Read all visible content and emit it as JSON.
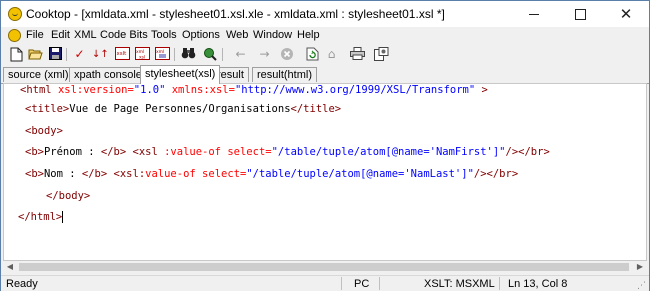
{
  "window": {
    "title": "Cooktop - [xmldata.xml - stylesheet01.xsl.xle - xmldata.xml : stylesheet01.xsl *]",
    "min_label": "",
    "max_label": "",
    "close_label": "✕"
  },
  "menu": {
    "items": [
      "File",
      "Edit",
      "XML",
      "Code Bits",
      "Tools",
      "Options",
      "Web",
      "Window",
      "Help"
    ]
  },
  "toolbar": {
    "buttons": [
      "new-file",
      "open-folder",
      "save",
      "check",
      "transform",
      "xslt",
      "xml-to-xsl",
      "xml-tree",
      "binoculars",
      "search-web",
      "back",
      "forward",
      "stop",
      "refresh",
      "home",
      "print",
      "options"
    ]
  },
  "tabs": {
    "items": [
      "source (xml)",
      "xpath console",
      "stylesheet(xsl)",
      "result",
      "result(html)"
    ],
    "active": "stylesheet(xsl)"
  },
  "editor": {
    "lines": [
      [
        {
          "c": "tag",
          "t": "<html "
        },
        {
          "c": "attr",
          "t": "xsl:version="
        },
        {
          "c": "val",
          "t": "\"1.0\""
        },
        {
          "c": "txt",
          "t": " "
        },
        {
          "c": "attr",
          "t": "xmlns:xsl="
        },
        {
          "c": "val",
          "t": "\"http://www.w3.org/1999/XSL/Transform\""
        },
        {
          "c": "tag",
          "t": " >"
        }
      ],
      [
        {
          "c": "tag",
          "t": "<title>"
        },
        {
          "c": "txt",
          "t": "Vue de Page Personnes/Organisations"
        },
        {
          "c": "tag",
          "t": "</title>"
        }
      ],
      [
        {
          "c": "tag",
          "t": "<body>"
        }
      ],
      [
        {
          "c": "tag",
          "t": "<b>"
        },
        {
          "c": "txt",
          "t": "Prénom : "
        },
        {
          "c": "tag",
          "t": "</b>"
        },
        {
          "c": "txt",
          "t": " "
        },
        {
          "c": "tag",
          "t": "<xsl "
        },
        {
          "c": "attr",
          "t": ":value-of"
        },
        {
          "c": "txt",
          "t": " "
        },
        {
          "c": "attr",
          "t": "select="
        },
        {
          "c": "val",
          "t": "\"/table/tuple/atom[@name='NamFirst']\""
        },
        {
          "c": "tag",
          "t": "/></br>"
        }
      ],
      [
        {
          "c": "tag",
          "t": "<b>"
        },
        {
          "c": "txt",
          "t": "Nom : "
        },
        {
          "c": "tag",
          "t": "</b>"
        },
        {
          "c": "txt",
          "t": " "
        },
        {
          "c": "tag",
          "t": "<xsl:"
        },
        {
          "c": "attr",
          "t": "value-of"
        },
        {
          "c": "txt",
          "t": " "
        },
        {
          "c": "attr",
          "t": "select="
        },
        {
          "c": "val",
          "t": "\"/table/tuple/atom[@name='NamLast']\""
        },
        {
          "c": "tag",
          "t": "/></br>"
        }
      ],
      [
        {
          "c": "tag",
          "t": "</body>"
        }
      ],
      [
        {
          "c": "tag",
          "t": "</html>"
        }
      ]
    ]
  },
  "status": {
    "ready": "Ready",
    "mode": "PC",
    "xslt": "XSLT: MSXML",
    "position": "Ln 13, Col 8"
  },
  "colors": {
    "tag": "#800000",
    "attr": "#ff0000",
    "value": "#0000ff",
    "text": "#000000"
  }
}
